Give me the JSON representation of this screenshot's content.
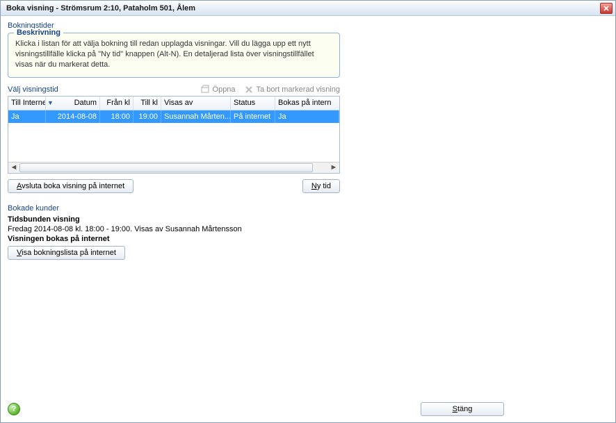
{
  "window": {
    "title": "Boka visning - Strömsrum 2:10, Pataholm 501, Ålem"
  },
  "booking_times": {
    "section_label": "Bokningstider",
    "description": {
      "legend": "Beskrivning",
      "text": "Klicka i listan för att välja bokning till redan upplagda visningar. Vill du lägga upp ett nytt visningstillfälle klicka på \"Ny tid\" knappen (Alt-N). En detaljerad lista över visningstillfället visas när du markerat detta."
    },
    "choose_label": "Välj visningstid",
    "toolbar": {
      "open": "Öppna",
      "remove": "Ta bort markerad visning"
    },
    "columns": {
      "till_internet": "Till Internet",
      "datum": "Datum",
      "fran_kl": "Från kl",
      "till_kl": "Till kl",
      "visas_av": "Visas av",
      "status": "Status",
      "bokas": "Bokas på intern"
    },
    "rows": [
      {
        "till_internet": "Ja",
        "datum": "2014-08-08",
        "fran_kl": "18:00",
        "till_kl": "19:00",
        "visas_av": "Susannah Mårten...",
        "status": "På internet",
        "bokas": "Ja"
      }
    ],
    "buttons": {
      "avsluta_prefix": "A",
      "avsluta_rest": "vsluta boka visning på internet",
      "nytid_prefix": "N",
      "nytid_rest": "y tid"
    }
  },
  "booked_customers": {
    "section_label": "Bokade kunder",
    "heading1": "Tidsbunden visning",
    "details": "Fredag 2014-08-08 kl. 18:00 - 19:00. Visas av Susannah Mårtensson",
    "heading2": "Visningen bokas på internet",
    "view_list_prefix": "V",
    "view_list_rest": "isa bokningslista på internet"
  },
  "footer": {
    "help": "?",
    "close_prefix": "S",
    "close_rest": "täng"
  }
}
